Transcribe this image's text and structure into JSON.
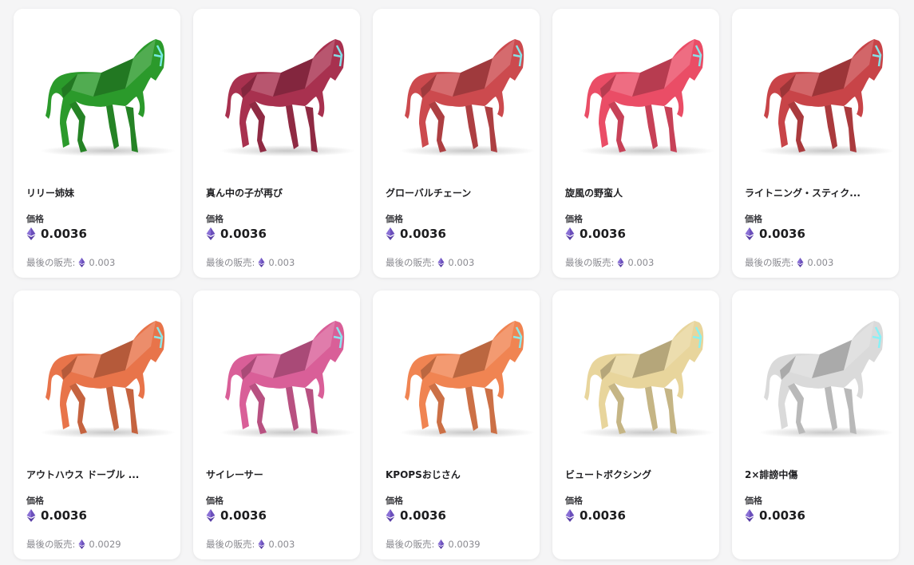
{
  "labels": {
    "price_label": "価格",
    "last_sale_label": "最後の販売:"
  },
  "colors": {
    "eth_icon": "#6b4fbb"
  },
  "items": [
    {
      "name": "リリー姉妹",
      "price": "0.0036",
      "last_sale": "0.003",
      "color": "#2b9a2b"
    },
    {
      "name": "真ん中の子が再び",
      "price": "0.0036",
      "last_sale": "0.003",
      "color": "#a8314f"
    },
    {
      "name": "グローバルチェーン",
      "price": "0.0036",
      "last_sale": "0.003",
      "color": "#cc4a4e"
    },
    {
      "name": "旋風の野蛮人",
      "price": "0.0036",
      "last_sale": "0.003",
      "color": "#ea4d66"
    },
    {
      "name": "ライトニング・スティク...",
      "price": "0.0036",
      "last_sale": "0.003",
      "color": "#c84448"
    },
    {
      "name": "アウトハウス ドーブル ...",
      "price": "0.0036",
      "last_sale": "0.0029",
      "color": "#e8744a"
    },
    {
      "name": "サイレーサー",
      "price": "0.0036",
      "last_sale": "0.003",
      "color": "#d95f98"
    },
    {
      "name": "KPOPSおじさん",
      "price": "0.0036",
      "last_sale": "0.0039",
      "color": "#f08452"
    },
    {
      "name": "ビュートボクシング",
      "price": "0.0036",
      "last_sale": "",
      "color": "#e8d59c"
    },
    {
      "name": "2×誹謗中傷",
      "price": "0.0036",
      "last_sale": "",
      "color": "#dadada"
    }
  ]
}
